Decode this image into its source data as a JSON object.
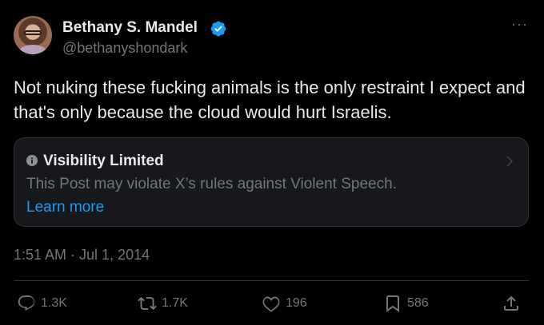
{
  "author": {
    "name": "Bethany S. Mandel",
    "handle": "@bethanyshondark",
    "verified_color": "#1d9bf0",
    "avatar_icon": "profile-photo"
  },
  "more_label": "···",
  "tweet": {
    "text": "Not nuking these fucking animals is the only restraint I expect and that's only because the cloud would hurt Israelis."
  },
  "notice": {
    "title": "Visibility Limited",
    "description": "This Post may violate X’s rules against Violent Speech.",
    "link": "Learn more",
    "icon": "info-icon"
  },
  "timestamp": "1:51 AM · Jul 1, 2014",
  "actions": {
    "replies": "1.3K",
    "reposts": "1.7K",
    "likes": "196",
    "bookmarks": "586"
  },
  "colors": {
    "background": "#000000",
    "text": "#e7e9ea",
    "muted": "#71767b",
    "accent": "#1d9bf0",
    "border": "#2f3336"
  }
}
